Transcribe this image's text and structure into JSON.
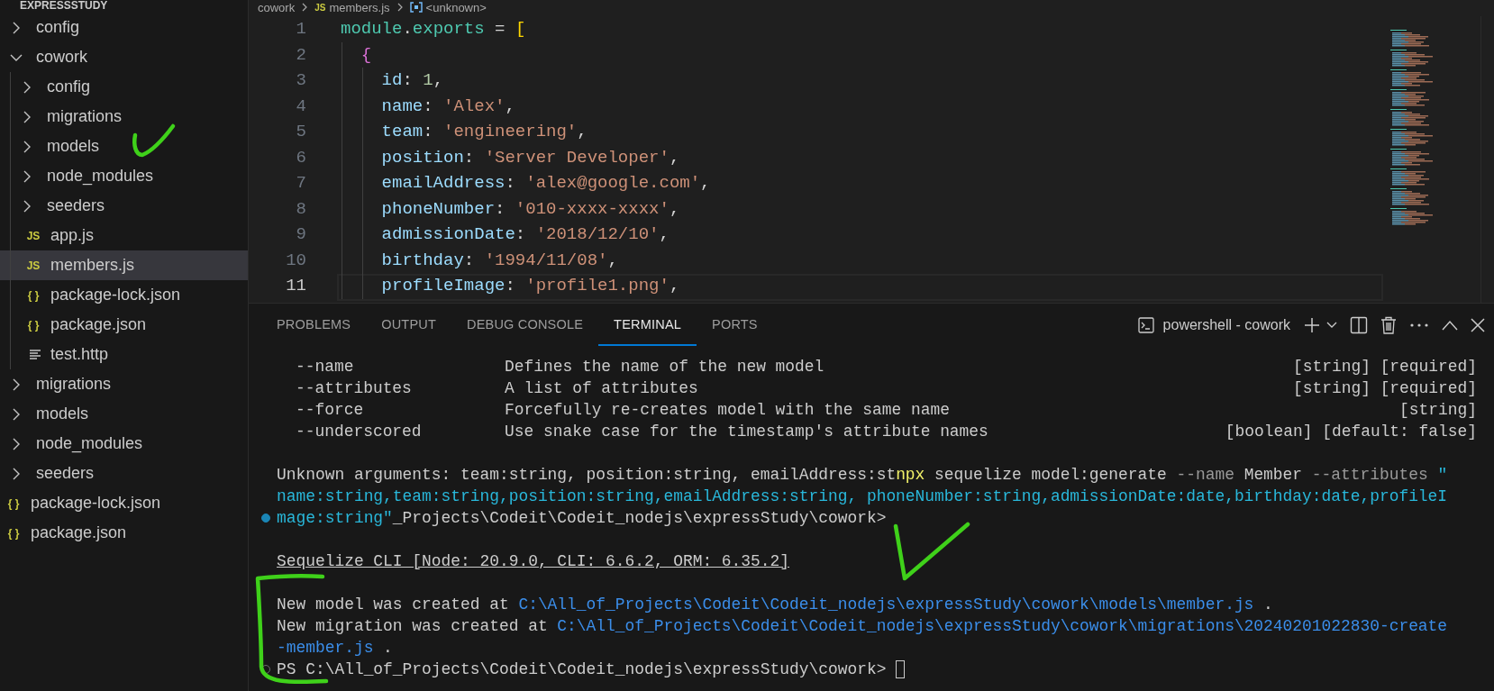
{
  "explorer": {
    "title": "EXPRESSSTUDY",
    "items": [
      {
        "label": "config",
        "kind": "folder",
        "expanded": false,
        "selected": false
      },
      {
        "label": "cowork",
        "kind": "folder",
        "expanded": true,
        "selected": false,
        "children": [
          {
            "label": "config",
            "kind": "folder",
            "expanded": false,
            "selected": false
          },
          {
            "label": "migrations",
            "kind": "folder",
            "expanded": false,
            "selected": false
          },
          {
            "label": "models",
            "kind": "folder",
            "expanded": false,
            "selected": false
          },
          {
            "label": "node_modules",
            "kind": "folder",
            "expanded": false,
            "selected": false
          },
          {
            "label": "seeders",
            "kind": "folder",
            "expanded": false,
            "selected": false
          },
          {
            "label": "app.js",
            "kind": "js",
            "badge": "JS",
            "selected": false
          },
          {
            "label": "members.js",
            "kind": "js",
            "badge": "JS",
            "selected": true
          },
          {
            "label": "package-lock.json",
            "kind": "json",
            "badge": "{ }",
            "selected": false
          },
          {
            "label": "package.json",
            "kind": "json",
            "badge": "{ }",
            "selected": false
          },
          {
            "label": "test.http",
            "kind": "text",
            "selected": false
          }
        ]
      },
      {
        "label": "migrations",
        "kind": "folder",
        "expanded": false,
        "selected": false
      },
      {
        "label": "models",
        "kind": "folder",
        "expanded": false,
        "selected": false
      },
      {
        "label": "node_modules",
        "kind": "folder",
        "expanded": false,
        "selected": false
      },
      {
        "label": "seeders",
        "kind": "folder",
        "expanded": false,
        "selected": false
      },
      {
        "label": "package-lock.json",
        "kind": "json",
        "badge": "{ }",
        "selected": false
      },
      {
        "label": "package.json",
        "kind": "json",
        "badge": "{ }",
        "selected": false
      }
    ]
  },
  "editor": {
    "breadcrumb": [
      {
        "kind": "folder",
        "text": "cowork"
      },
      {
        "kind": "js",
        "badge": "JS",
        "text": "members.js"
      },
      {
        "kind": "symbol",
        "text": "<unknown>"
      }
    ],
    "lines": [
      {
        "number": "1",
        "current": false,
        "tokens": [
          {
            "kind": "module",
            "text": "module"
          },
          {
            "kind": "punct",
            "text": "."
          },
          {
            "kind": "module",
            "text": "exports"
          },
          {
            "kind": "punct",
            "text": " = "
          },
          {
            "kind": "bracket1",
            "text": "["
          }
        ]
      },
      {
        "number": "2",
        "current": false,
        "tokens": [
          {
            "kind": "bracket2",
            "text": "  {"
          }
        ]
      },
      {
        "number": "3",
        "current": false,
        "tokens": [
          {
            "kind": "key",
            "text": "    id"
          },
          {
            "kind": "punct",
            "text": ": "
          },
          {
            "kind": "number",
            "text": "1"
          },
          {
            "kind": "punct",
            "text": ","
          }
        ]
      },
      {
        "number": "4",
        "current": false,
        "tokens": [
          {
            "kind": "key",
            "text": "    name"
          },
          {
            "kind": "punct",
            "text": ": "
          },
          {
            "kind": "string",
            "text": "'Alex'"
          },
          {
            "kind": "punct",
            "text": ","
          }
        ]
      },
      {
        "number": "5",
        "current": false,
        "tokens": [
          {
            "kind": "key",
            "text": "    team"
          },
          {
            "kind": "punct",
            "text": ": "
          },
          {
            "kind": "string",
            "text": "'engineering'"
          },
          {
            "kind": "punct",
            "text": ","
          }
        ]
      },
      {
        "number": "6",
        "current": false,
        "tokens": [
          {
            "kind": "key",
            "text": "    position"
          },
          {
            "kind": "punct",
            "text": ": "
          },
          {
            "kind": "string",
            "text": "'Server Developer'"
          },
          {
            "kind": "punct",
            "text": ","
          }
        ]
      },
      {
        "number": "7",
        "current": false,
        "tokens": [
          {
            "kind": "key",
            "text": "    emailAddress"
          },
          {
            "kind": "punct",
            "text": ": "
          },
          {
            "kind": "string",
            "text": "'alex@google.com'"
          },
          {
            "kind": "punct",
            "text": ","
          }
        ]
      },
      {
        "number": "8",
        "current": false,
        "tokens": [
          {
            "kind": "key",
            "text": "    phoneNumber"
          },
          {
            "kind": "punct",
            "text": ": "
          },
          {
            "kind": "string",
            "text": "'010-xxxx-xxxx'"
          },
          {
            "kind": "punct",
            "text": ","
          }
        ]
      },
      {
        "number": "9",
        "current": false,
        "tokens": [
          {
            "kind": "key",
            "text": "    admissionDate"
          },
          {
            "kind": "punct",
            "text": ": "
          },
          {
            "kind": "string",
            "text": "'2018/12/10'"
          },
          {
            "kind": "punct",
            "text": ","
          }
        ]
      },
      {
        "number": "10",
        "current": false,
        "tokens": [
          {
            "kind": "key",
            "text": "    birthday"
          },
          {
            "kind": "punct",
            "text": ": "
          },
          {
            "kind": "string",
            "text": "'1994/11/08'"
          },
          {
            "kind": "punct",
            "text": ","
          }
        ]
      },
      {
        "number": "11",
        "current": true,
        "tokens": [
          {
            "kind": "key",
            "text": "    profileImage"
          },
          {
            "kind": "punct",
            "text": ": "
          },
          {
            "kind": "string",
            "text": "'profile1.png'"
          },
          {
            "kind": "punct",
            "text": ","
          }
        ]
      }
    ]
  },
  "panel": {
    "tabs": [
      {
        "label": "PROBLEMS",
        "selected": false
      },
      {
        "label": "OUTPUT",
        "selected": false
      },
      {
        "label": "DEBUG CONSOLE",
        "selected": false
      },
      {
        "label": "TERMINAL",
        "selected": true
      },
      {
        "label": "PORTS",
        "selected": false
      }
    ],
    "terminal_name": "powershell - cowork",
    "lines": [
      {
        "kind": "option",
        "flag": "--name",
        "description": "Defines the name of the new model",
        "types": "[string] [required]"
      },
      {
        "kind": "option",
        "flag": "--attributes",
        "description": "A list of attributes",
        "types": "[string] [required]"
      },
      {
        "kind": "option",
        "flag": "--force",
        "description": "Forcefully re-creates model with the same name",
        "types": "[string]"
      },
      {
        "kind": "option",
        "flag": "--underscored",
        "description": "Use snake case for the timestamp's attribute names",
        "types": "[boolean] [default: false]"
      },
      {
        "kind": "blank"
      },
      {
        "kind": "output",
        "segments": [
          {
            "kind": "plain",
            "text": "Unknown arguments: team:string, position:string, emailAddress:st"
          },
          {
            "kind": "command",
            "text": "npx"
          },
          {
            "kind": "plain",
            "text": " sequelize model:generate "
          },
          {
            "kind": "flag",
            "text": "--name"
          },
          {
            "kind": "plain",
            "text": " Member "
          },
          {
            "kind": "flag",
            "text": "--attributes"
          },
          {
            "kind": "argument",
            "text": " \""
          }
        ]
      },
      {
        "kind": "output",
        "segments": [
          {
            "kind": "argument",
            "text": "name:string,team:string,position:string,emailAddress:string, phoneNumber:string,admissionDate:date,birthday:date,profileI"
          }
        ]
      },
      {
        "kind": "output",
        "marker": {
          "kind": "success"
        },
        "segments": [
          {
            "kind": "argument",
            "text": "mage:string\""
          },
          {
            "kind": "plain",
            "text": "_Projects\\Codeit\\Codeit_nodejs\\expressStudy\\cowork>"
          }
        ]
      },
      {
        "kind": "blank"
      },
      {
        "kind": "banner",
        "text": "Sequelize CLI [Node: 20.9.0, CLI: 6.6.2, ORM: 6.35.2]"
      },
      {
        "kind": "blank"
      },
      {
        "kind": "output",
        "segments": [
          {
            "kind": "plain",
            "text": "New model was created at "
          },
          {
            "kind": "link",
            "text": "C:\\All_of_Projects\\Codeit\\Codeit_nodejs\\expressStudy\\cowork\\models\\member.js"
          },
          {
            "kind": "plain",
            "text": " ."
          }
        ]
      },
      {
        "kind": "output",
        "segments": [
          {
            "kind": "plain",
            "text": "New migration was created at "
          },
          {
            "kind": "link",
            "text": "C:\\All_of_Projects\\Codeit\\Codeit_nodejs\\expressStudy\\cowork\\migrations\\20240201022830-create"
          }
        ]
      },
      {
        "kind": "output",
        "segments": [
          {
            "kind": "link",
            "text": "-member.js"
          },
          {
            "kind": "plain",
            "text": " ."
          }
        ]
      },
      {
        "kind": "prompt",
        "marker": {
          "kind": "pending"
        },
        "text": "PS C:\\All_of_Projects\\Codeit\\Codeit_nodejs\\expressStudy\\cowork>",
        "cursor": true
      }
    ]
  }
}
